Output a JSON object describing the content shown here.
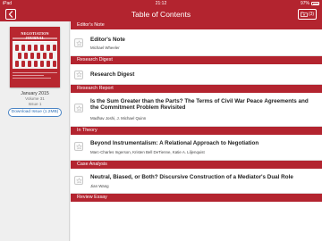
{
  "status": {
    "device": "iPad",
    "time": "21:12",
    "battery": "97%"
  },
  "nav": {
    "title": "Table of Contents",
    "count": "(3)"
  },
  "sidebar": {
    "cover_title": "NEGOTIATION JOURNAL",
    "issue_date": "January 2015",
    "volume": "Volume 31",
    "issue": "Issue 1",
    "download_label": "Download Issue (1.2MB)"
  },
  "sections": [
    {
      "header": "Editor's Note",
      "title": "Editor's Note",
      "authors": "Michael Wheeler"
    },
    {
      "header": "Research Digest",
      "title": "Research Digest",
      "authors": ""
    },
    {
      "header": "Research Report",
      "title": "Is the Sum Greater than the Parts? The Terms of Civil War Peace Agreements and the Commitment Problem Revisited",
      "authors": "Madhav Joshi, J. Michael Quinn"
    },
    {
      "header": "In Theory",
      "title": "Beyond Instrumentalism: A Relational Approach to Negotiation",
      "authors": "Marc-Charles Ingerson, Kristen Bell DeTienne, Katie A. Liljenquist"
    },
    {
      "header": "Case Analysis",
      "title": "Neutral, Biased, or Both? Discursive Construction of a Mediator's Dual Role",
      "authors": "Jian Wang"
    },
    {
      "header": "Review Essay"
    }
  ]
}
